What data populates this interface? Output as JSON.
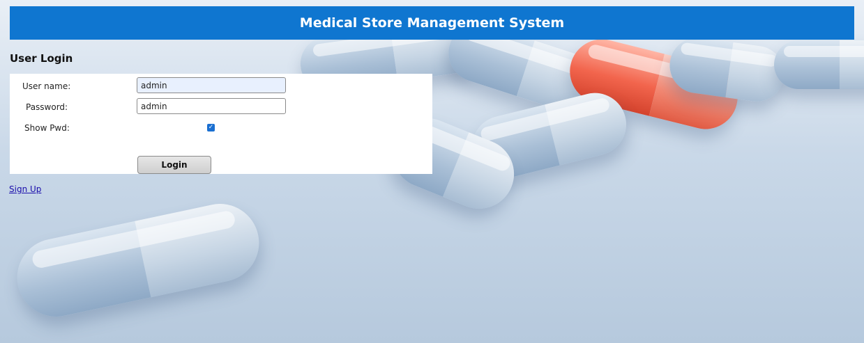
{
  "header": {
    "title": "Medical Store Management System"
  },
  "login": {
    "section_title": "User Login",
    "username_label": "User name:",
    "username_value": "admin",
    "password_label": "Password:",
    "password_value": "admin",
    "show_pwd_label": "Show Pwd:",
    "show_pwd_checked": true,
    "login_button_label": "Login"
  },
  "links": {
    "signup_label": "Sign Up"
  },
  "colors": {
    "header_bg": "#0f76d0",
    "link": "#1a0dab",
    "checkbox_accent": "#1a6fd1"
  },
  "icons": {
    "checkbox_check": "check-icon"
  }
}
